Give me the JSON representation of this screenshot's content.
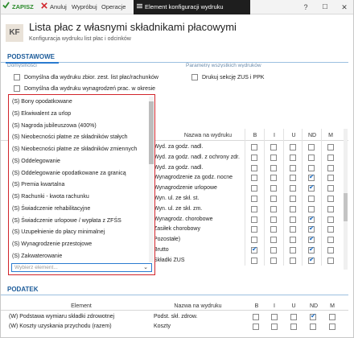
{
  "toolbar": {
    "save": "ZAPISZ",
    "cancel": "Anuluj",
    "try": "Wypróbuj",
    "operations": "Operacje",
    "window_title": "Element konfiguracji wydruku",
    "help": "?",
    "minimize": "☐",
    "close": "✕"
  },
  "header": {
    "badge": "KF",
    "title": "Lista płac z własnymi składnikami płacowymi",
    "subtitle": "Konfiguracja wydruku list płac i odcinków"
  },
  "sections": {
    "basic": "PODSTAWOWE",
    "tax": "PODATEK"
  },
  "basic": {
    "defaults_label": "Domyślności",
    "params_label": "Parametry wszystkich wydruków",
    "options": [
      {
        "label": "Domyślna dla wydruku zbior. zest. list płac/rachunków",
        "checked": false
      },
      {
        "label": "Domyślna dla wydruku wynagrodzeń prac. w okresie",
        "checked": false
      }
    ],
    "print_zus": {
      "label": "Drukuj sekcję ZUS i PPK",
      "checked": false
    }
  },
  "main_table": {
    "headers": {
      "name": "Nazwa na wydruku",
      "b": "B",
      "i": "I",
      "u": "U",
      "nd": "ND",
      "m": "M"
    },
    "rows": [
      {
        "name": "Wyd. za godz. nadl.",
        "b": false,
        "i": false,
        "u": false,
        "nd": false,
        "m": false
      },
      {
        "name": "Wyd. za godz. nadl. z ochrony zdr.",
        "b": false,
        "i": false,
        "u": false,
        "nd": false,
        "m": false
      },
      {
        "name": "Wyd. za godz. nadl.",
        "b": false,
        "i": false,
        "u": false,
        "nd": false,
        "m": false
      },
      {
        "name": "Wynagrodzenie za godz. nocne",
        "b": false,
        "i": false,
        "u": false,
        "nd": true,
        "m": false
      },
      {
        "name": "Wynagrodzenie urlopowe",
        "b": false,
        "i": false,
        "u": false,
        "nd": true,
        "m": false
      },
      {
        "name": "Wyn. ul. ze skł. st.",
        "b": false,
        "i": false,
        "u": false,
        "nd": false,
        "m": false
      },
      {
        "name": "Wyn. ul. ze skł. zm.",
        "b": false,
        "i": false,
        "u": false,
        "nd": false,
        "m": false
      },
      {
        "name": "Wynagrodz. chorobowe",
        "b": false,
        "i": false,
        "u": false,
        "nd": true,
        "m": false
      },
      {
        "name": "Zasiłek chorobowy",
        "b": false,
        "i": false,
        "u": false,
        "nd": true,
        "m": false
      },
      {
        "name": "Pozostałe)",
        "b": false,
        "i": false,
        "u": false,
        "nd": true,
        "m": false
      },
      {
        "name": "Brutto",
        "b": true,
        "i": false,
        "u": false,
        "nd": true,
        "m": false
      },
      {
        "name": "Składki ZUS",
        "b": false,
        "i": false,
        "u": false,
        "nd": true,
        "m": false
      }
    ]
  },
  "dropdown": {
    "items": [
      "(S) Bony opodatkowane",
      "(S) Ekwiwalent za urlop",
      "(S) Nagroda jubileuszowa (400%)",
      "(S) Nieobecności płatne ze składników stałych",
      "(S) Nieobecności płatne ze składników zmiennych",
      "(S) Oddelegowanie",
      "(S) Oddelegowanie opodatkowane za granicą",
      "(S) Premia kwartalna",
      "(S) Rachunki - kwota rachunku",
      "(S) Świadczenie rehabilitacyjne",
      "(S) Świadczenie urlopowe / wypłata z ZFŚS",
      "(S) Uzupełnienie do płacy minimalnej",
      "(S) Wynagrodzenie przestojowe",
      "(S) Zakwaterowanie"
    ],
    "placeholder": "Wybierz element..."
  },
  "tax_table": {
    "headers": {
      "element": "Element",
      "name": "Nazwa na wydruku",
      "b": "B",
      "i": "I",
      "u": "U",
      "nd": "ND",
      "m": "M"
    },
    "rows": [
      {
        "element": "(W) Podstawa wymiaru składki zdrowotnej",
        "name": "Podst. skł. zdrow.",
        "b": false,
        "i": false,
        "u": false,
        "nd": true,
        "m": false
      },
      {
        "element": "(W) Koszty uzyskania przychodu (razem)",
        "name": "Koszty",
        "b": false,
        "i": false,
        "u": false,
        "nd": false,
        "m": false
      }
    ]
  },
  "colors": {
    "accent": "#2a7bd0",
    "danger": "#d1242b",
    "toolbar_dark": "#1e1e1e"
  }
}
